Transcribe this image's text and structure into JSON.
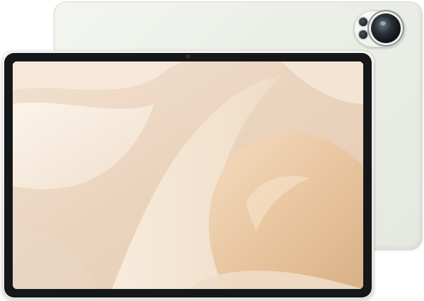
{
  "image": {
    "subject": "tablet",
    "colors": {
      "back_panel": "#eceee8",
      "frame": "#f0eee8",
      "bezel": "#15171a",
      "wallpaper_base": "#ecd7c3",
      "wallpaper_light": "#f8eee2",
      "wallpaper_gold": "#e9c9a2"
    },
    "icons": {
      "main_lens": "camera-lens-icon",
      "secondary_lens": "camera-lens-icon",
      "front_camera": "front-camera-icon"
    }
  }
}
